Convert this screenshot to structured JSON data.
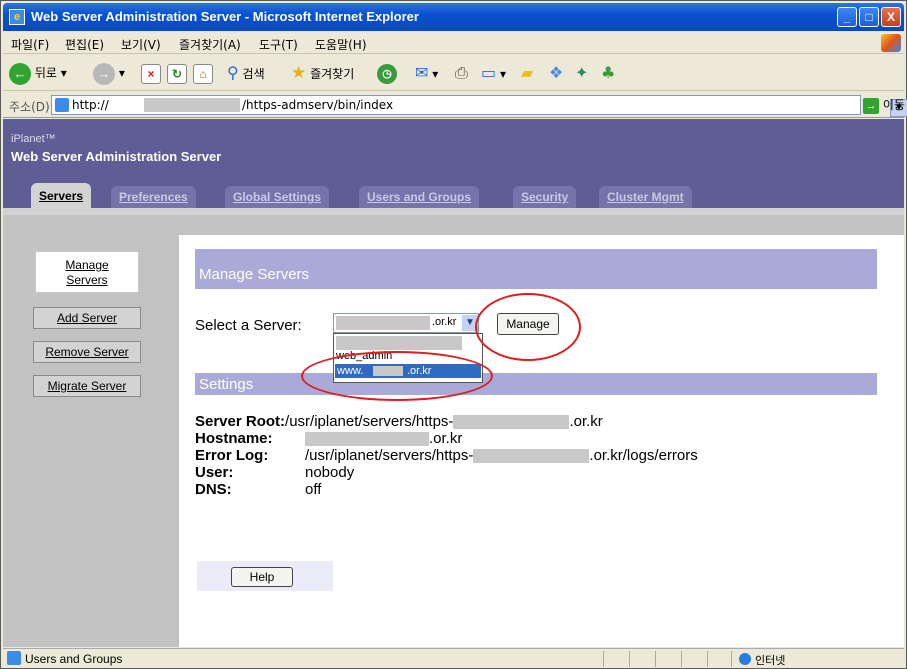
{
  "window": {
    "title": "Web Server Administration Server - Microsoft Internet Explorer",
    "controls": {
      "minimize": "_",
      "maximize": "□",
      "close": "X"
    }
  },
  "menu": [
    "파일(F)",
    "편집(E)",
    "보기(V)",
    "즐겨찾기(A)",
    "도구(T)",
    "도움말(H)"
  ],
  "toolbar": {
    "back": "뒤로",
    "search": "검색",
    "favorites": "즐겨찾기"
  },
  "address": {
    "label": "주소(D)",
    "prefix": "http://",
    "path": "/https-admserv/bin/index",
    "go": "이동"
  },
  "banner": {
    "brand": "iPlanet™",
    "app_title": "Web Server Administration Server"
  },
  "tabs": [
    "Servers",
    "Preferences",
    "Global Settings",
    "Users and Groups",
    "Security",
    "Cluster Mgmt"
  ],
  "sidebar": {
    "manage_line1": "Manage",
    "manage_line2": "Servers",
    "add": "Add Server",
    "remove": "Remove Server",
    "migrate": "Migrate Server"
  },
  "manage": {
    "heading": "Manage Servers",
    "select_label": "Select a Server:",
    "selected_suffix": ".or.kr",
    "manage_button": "Manage",
    "options": [
      "web_admin",
      "www.",
      ".or.kr"
    ]
  },
  "settings": {
    "heading": "Settings",
    "server_root_key": "Server Root:",
    "server_root_val": "/usr/iplanet/servers/https-",
    "server_root_suffix": ".or.kr",
    "hostname_key": "Hostname:",
    "hostname_suffix": ".or.kr",
    "errorlog_key": "Error Log:",
    "errorlog_val": "/usr/iplanet/servers/https-",
    "errorlog_suffix": ".or.kr/logs/errors",
    "user_key": "User:",
    "user_val": "nobody",
    "dns_key": "DNS:",
    "dns_val": "off"
  },
  "help_button": "Help",
  "status": {
    "text": "Users and Groups",
    "zone": "인터넷"
  },
  "colors": {
    "banner": "#5e5d95",
    "section": "#aaaad8",
    "highlight": "#316ac5",
    "annotation": "#e01c1c"
  }
}
